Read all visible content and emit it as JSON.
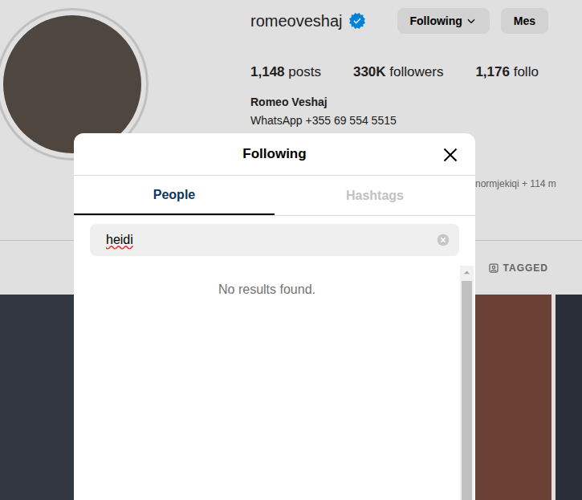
{
  "profile": {
    "username": "romeoveshaj",
    "verified": true,
    "buttons": [
      {
        "label": "Following",
        "dropdown": true
      },
      {
        "label": "Mes",
        "dropdown": false
      }
    ],
    "stats": [
      {
        "value": "1,148",
        "label": "posts"
      },
      {
        "value": "330K",
        "label": "followers"
      },
      {
        "value": "1,176",
        "label": "follo"
      }
    ],
    "name": "Romeo Veshaj",
    "bio": "WhatsApp +355 69 554 5515",
    "followed_by": "normjekiqi + 114 m"
  },
  "post_tabs": [
    {
      "label": "TAGGED",
      "selected": false
    }
  ],
  "dialog": {
    "title": "Following",
    "tabs": [
      {
        "label": "People",
        "selected": true
      },
      {
        "label": "Hashtags",
        "selected": false
      }
    ],
    "search": {
      "value": "heidi",
      "misspelled": true
    },
    "empty_message": "No results found."
  }
}
